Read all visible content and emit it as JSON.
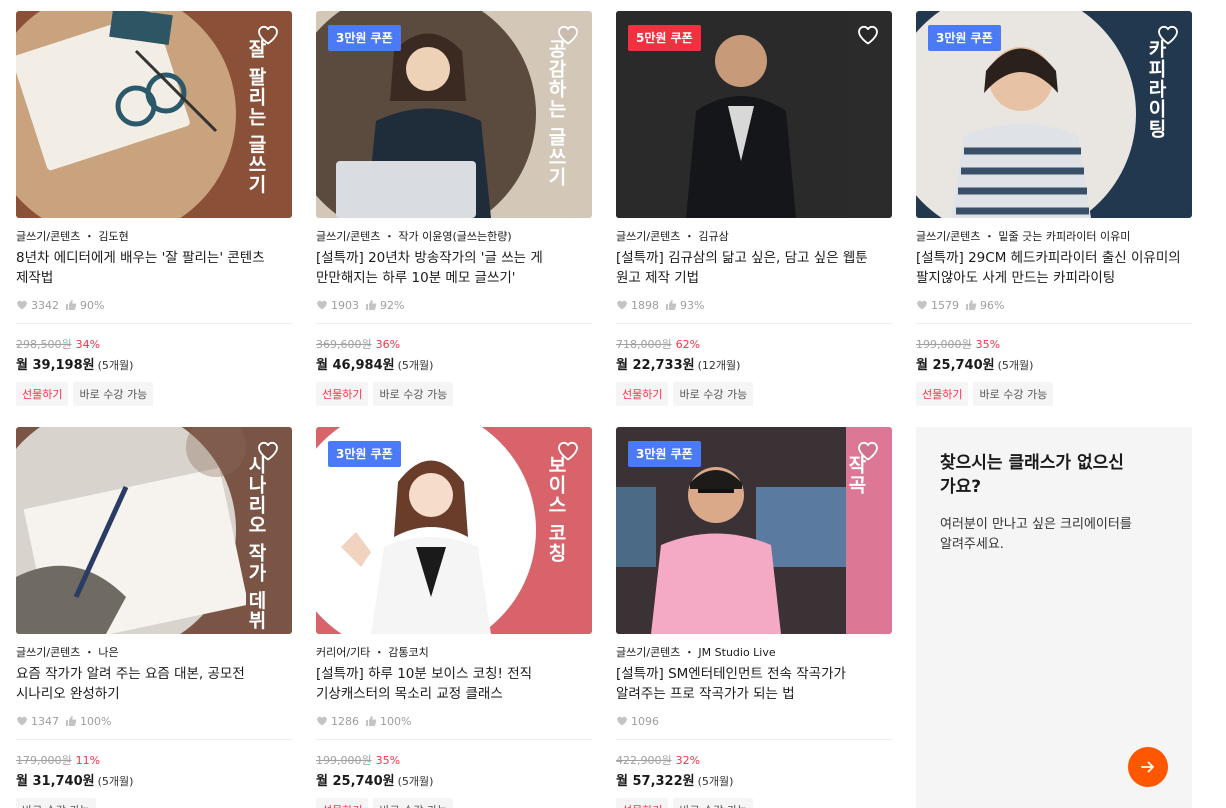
{
  "cards": [
    {
      "vtext": "잘 팔리는 글쓰기",
      "coupon": "",
      "meta": "글쓰기/콘텐츠 ・ 김도현",
      "title": "8년차 에디터에게 배우는 '잘 팔리는' 콘텐츠 제작법",
      "likes": "3342",
      "rating": "90%",
      "orig_price": "298,500원",
      "discount": "34%",
      "price": "월 39,198원",
      "months": "(5개월)",
      "gift": "선물하기",
      "instant": "바로 수강 가능",
      "colors": {
        "bg": "#8a5138",
        "circle": "#c9a27e"
      }
    },
    {
      "vtext": "공감하는 글쓰기",
      "coupon": "3만원 쿠폰",
      "meta": "글쓰기/콘텐츠 ・ 작가 이윤영(글쓰는한량)",
      "title": "[설특까] 20년차 방송작가의 '글 쓰는 게 만만해지는 하루 10분 메모 글쓰기'",
      "likes": "1903",
      "rating": "92%",
      "orig_price": "369,600원",
      "discount": "36%",
      "price": "월 46,984원",
      "months": "(5개월)",
      "gift": "선물하기",
      "instant": "바로 수강 가능",
      "colors": {
        "bg": "#d3c7b7",
        "circle": "#5b4b3e"
      }
    },
    {
      "vtext": "",
      "coupon": "5만원 쿠폰",
      "meta": "글쓰기/콘텐츠 ・ 김규삼",
      "title": "[설특까] 김규삼의 닮고 싶은, 담고 싶은 웹툰 원고 제작 기법",
      "likes": "1898",
      "rating": "93%",
      "orig_price": "718,000원",
      "discount": "62%",
      "price": "월 22,733원",
      "months": "(12개월)",
      "gift": "선물하기",
      "instant": "바로 수강 가능",
      "colors": {
        "bg": "#2b2b2b",
        "circle": "#3d3d3d"
      }
    },
    {
      "vtext": "카피라이팅",
      "coupon": "3만원 쿠폰",
      "meta": "글쓰기/콘텐츠 ・ 밑줄 긋는 카피라이터 이유미",
      "title": "[설특까] 29CM 헤드카피라이터 출신 이유미의 팔지않아도 사게 만드는 카피라이팅",
      "likes": "1579",
      "rating": "96%",
      "orig_price": "199,000원",
      "discount": "35%",
      "price": "월 25,740원",
      "months": "(5개월)",
      "gift": "선물하기",
      "instant": "바로 수강 가능",
      "colors": {
        "bg": "#22384f",
        "circle": "#e9e6e1"
      }
    },
    {
      "vtext": "시나리오 작가 데뷔",
      "coupon": "",
      "meta": "글쓰기/콘텐츠 ・ 나은",
      "title": "요즘 작가가 알려 주는 요즘 대본, 공모전 시나리오 완성하기",
      "likes": "1347",
      "rating": "100%",
      "orig_price": "179,000원",
      "discount": "11%",
      "price": "월 31,740원",
      "months": "(5개월)",
      "gift": "",
      "instant": "바로 수강 가능",
      "colors": {
        "bg": "#7a5546",
        "circle": "#d9d3cd"
      }
    },
    {
      "vtext": "보이스 코칭",
      "coupon": "3만원 쿠폰",
      "meta": "커리어/기타 ・ 감통코치",
      "title": "[설특까] 하루 10분 보이스 코칭! 전직 기상캐스터의 목소리 교정 클래스",
      "likes": "1286",
      "rating": "100%",
      "orig_price": "199,000원",
      "discount": "35%",
      "price": "월 25,740원",
      "months": "(5개월)",
      "gift": "선물하기",
      "instant": "바로 수강 가능",
      "colors": {
        "bg": "#d9636a",
        "circle": "#ffffff"
      }
    },
    {
      "vtext": "작곡",
      "coupon": "3만원 쿠폰",
      "meta": "글쓰기/콘텐츠 ・ JM Studio Live",
      "title": "[설특까] SM엔터테인먼트 전속 작곡가가 알려주는 프로 작곡가가 되는 법",
      "likes": "1096",
      "rating": "",
      "orig_price": "422,900원",
      "discount": "32%",
      "price": "월 57,322원",
      "months": "(5개월)",
      "gift": "선물하기",
      "instant": "바로 수강 가능",
      "colors": {
        "bg": "#dc7896",
        "circle": "#6a5a55"
      }
    }
  ],
  "ask": {
    "heading": "찾으시는 클래스가 없으신가요?",
    "body": "여러분이 만나고 싶은 크리에이터를 알려주세요."
  },
  "colors": {
    "accent": "#ff5600",
    "discount": "#fd3049",
    "coupon_blue": "#4a7af5",
    "coupon_red": "#f2303f"
  }
}
